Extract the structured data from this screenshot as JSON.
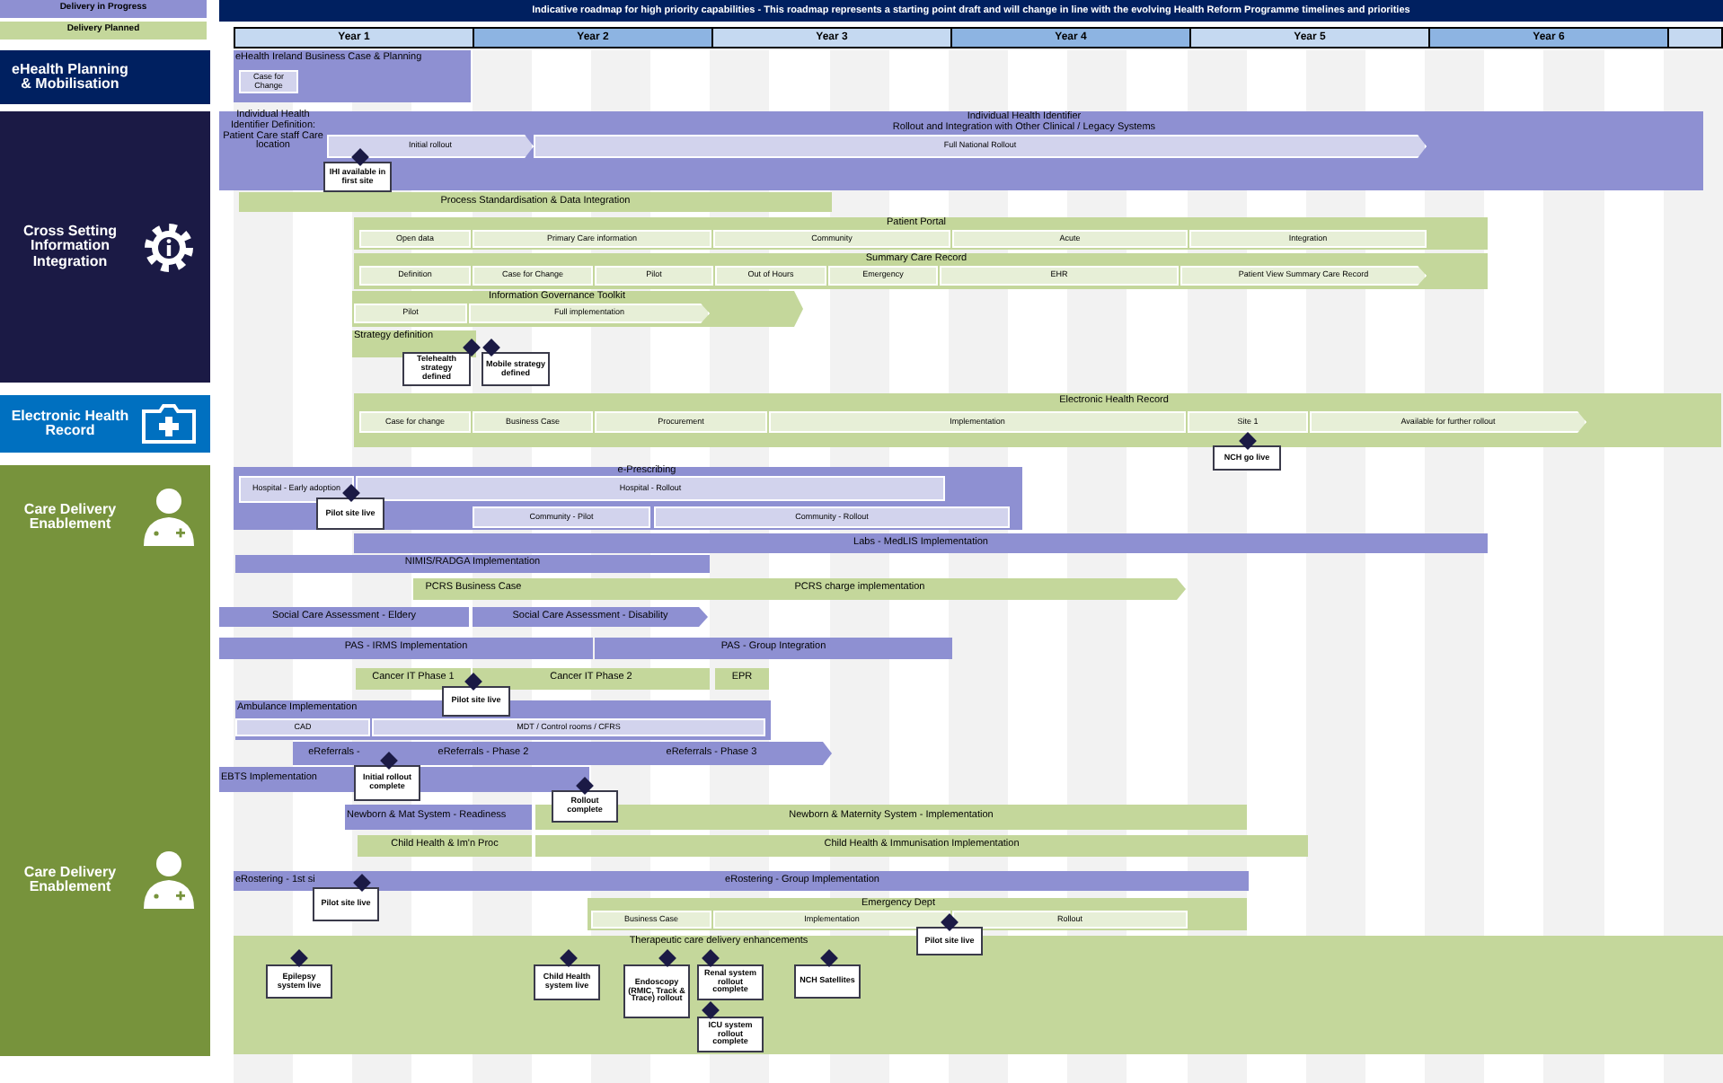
{
  "legend": [
    {
      "label": "Delivery in Progress",
      "color": "#8e90d2"
    },
    {
      "label": "Delivery Planned",
      "color": "#c4d79b"
    }
  ],
  "title": "Indicative roadmap for high priority capabilities - This roadmap represents a starting point draft and will change in line with the evolving Health Reform Programme timelines and priorities",
  "years": [
    "Year 1",
    "Year 2",
    "Year 3",
    "Year 4",
    "Year 5",
    "Year 6"
  ],
  "sections": [
    {
      "kind": "planning",
      "labels": [
        "eHealth Planning & Mobilisation"
      ]
    },
    {
      "kind": "integration",
      "labels": [
        "Cross Setting Information Integration"
      ]
    },
    {
      "kind": "ehr",
      "labels": [
        "Electronic Health Record"
      ]
    },
    {
      "kind": "care",
      "labels": [
        "Care Delivery Enablement",
        "Care Delivery Enablement"
      ]
    }
  ],
  "items": [
    {
      "color": "#8e90d2",
      "title": "eHealth Ireland Business Case & Planning",
      "segments": [
        "Case for Change"
      ]
    },
    {
      "color": "#8e90d2",
      "title": "Individual Health Identifier\nRollout and Integration with Other Clinical / Legacy Systems",
      "side_label": "Individual Health Identifier Definition: Patient Care staff Care location",
      "segments": [
        "Initial rollout",
        "Full National Rollout"
      ]
    },
    {
      "color": "#c4d79b",
      "title": "Process Standardisation & Data Integration"
    },
    {
      "color": "#c4d79b",
      "title": "Patient Portal",
      "segments": [
        "Open data",
        "Primary Care information",
        "Community",
        "Acute",
        "Integration"
      ]
    },
    {
      "color": "#c4d79b",
      "title": "Summary Care Record",
      "segments": [
        "Definition",
        "Case for Change",
        "Pilot",
        "Out of Hours",
        "Emergency",
        "EHR",
        "Patient View Summary Care Record"
      ]
    },
    {
      "color": "#c4d79b",
      "title": "Information Governance Toolkit",
      "segments": [
        "Pilot",
        "Full implementation"
      ]
    },
    {
      "color": "#c4d79b",
      "title": "Strategy definition"
    },
    {
      "color": "#c4d79b",
      "title": "Electronic Health Record",
      "segments": [
        "Case for change",
        "Business Case",
        "Procurement",
        "Implementation",
        "Site 1",
        "Available for further rollout"
      ]
    },
    {
      "color": "#8e90d2",
      "title": "e-Prescribing",
      "segments": [
        "Hospital - Early adoption",
        "Hospital - Rollout",
        "Community - Pilot",
        "Community - Rollout"
      ]
    },
    {
      "color": "#8e90d2",
      "title": "Labs - MedLIS Implementation"
    },
    {
      "color": "#8e90d2",
      "title": "NIMIS/RADGA Implementation"
    },
    {
      "color": "#c4d79b",
      "title": "PCRS Business Case"
    },
    {
      "color": "#c4d79b",
      "title": "PCRS charge implementation"
    },
    {
      "color": "#8e90d2",
      "title": "Social Care Assessment - Eldery"
    },
    {
      "color": "#8e90d2",
      "title": "Social Care Assessment - Disability"
    },
    {
      "color": "#8e90d2",
      "title": "PAS - IRMS Implementation"
    },
    {
      "color": "#8e90d2",
      "title": "PAS - Group Integration"
    },
    {
      "color": "#c4d79b",
      "title": "Cancer IT Phase 1"
    },
    {
      "color": "#c4d79b",
      "title": "Cancer IT Phase 2"
    },
    {
      "color": "#c4d79b",
      "title": "EPR"
    },
    {
      "color": "#8e90d2",
      "title": "Ambulance Implementation",
      "segments": [
        "CAD",
        "MDT / Control rooms / CFRS"
      ]
    },
    {
      "color": "#8e90d2",
      "title": "eReferrals -"
    },
    {
      "color": "#8e90d2",
      "title": "eReferrals - Phase 2"
    },
    {
      "color": "#8e90d2",
      "title": "eReferrals - Phase 3"
    },
    {
      "color": "#8e90d2",
      "title": "EBTS Implementation"
    },
    {
      "color": "#8e90d2",
      "title": "Newborn & Mat System - Readiness"
    },
    {
      "color": "#c4d79b",
      "title": "Newborn & Maternity System - Implementation"
    },
    {
      "color": "#c4d79b",
      "title": "Child Health & Im'n Proc"
    },
    {
      "color": "#c4d79b",
      "title": "Child Health & Immunisation Implementation"
    },
    {
      "color": "#8e90d2",
      "title": "eRostering - 1st si"
    },
    {
      "color": "#8e90d2",
      "title": "eRostering - Group Implementation"
    },
    {
      "color": "#c4d79b",
      "title": "Emergency Dept",
      "segments": [
        "Business Case",
        "Implementation",
        "Rollout"
      ]
    },
    {
      "color": "#c4d79b",
      "title": "Therapeutic care delivery enhancements"
    }
  ],
  "milestones": [
    "IHI available in first site",
    "Telehealth strategy defined",
    "Mobile strategy defined",
    "NCH go live",
    "Pilot site live",
    "Pilot site live",
    "Initial rollout complete",
    "Rollout complete",
    "Pilot site live",
    "Pilot site live",
    "Epilepsy system live",
    "Child Health system live",
    "Endoscopy (RMIC, Track & Trace) rollout",
    "Renal system rollout complete",
    "ICU system rollout complete",
    "NCH Satellites"
  ]
}
